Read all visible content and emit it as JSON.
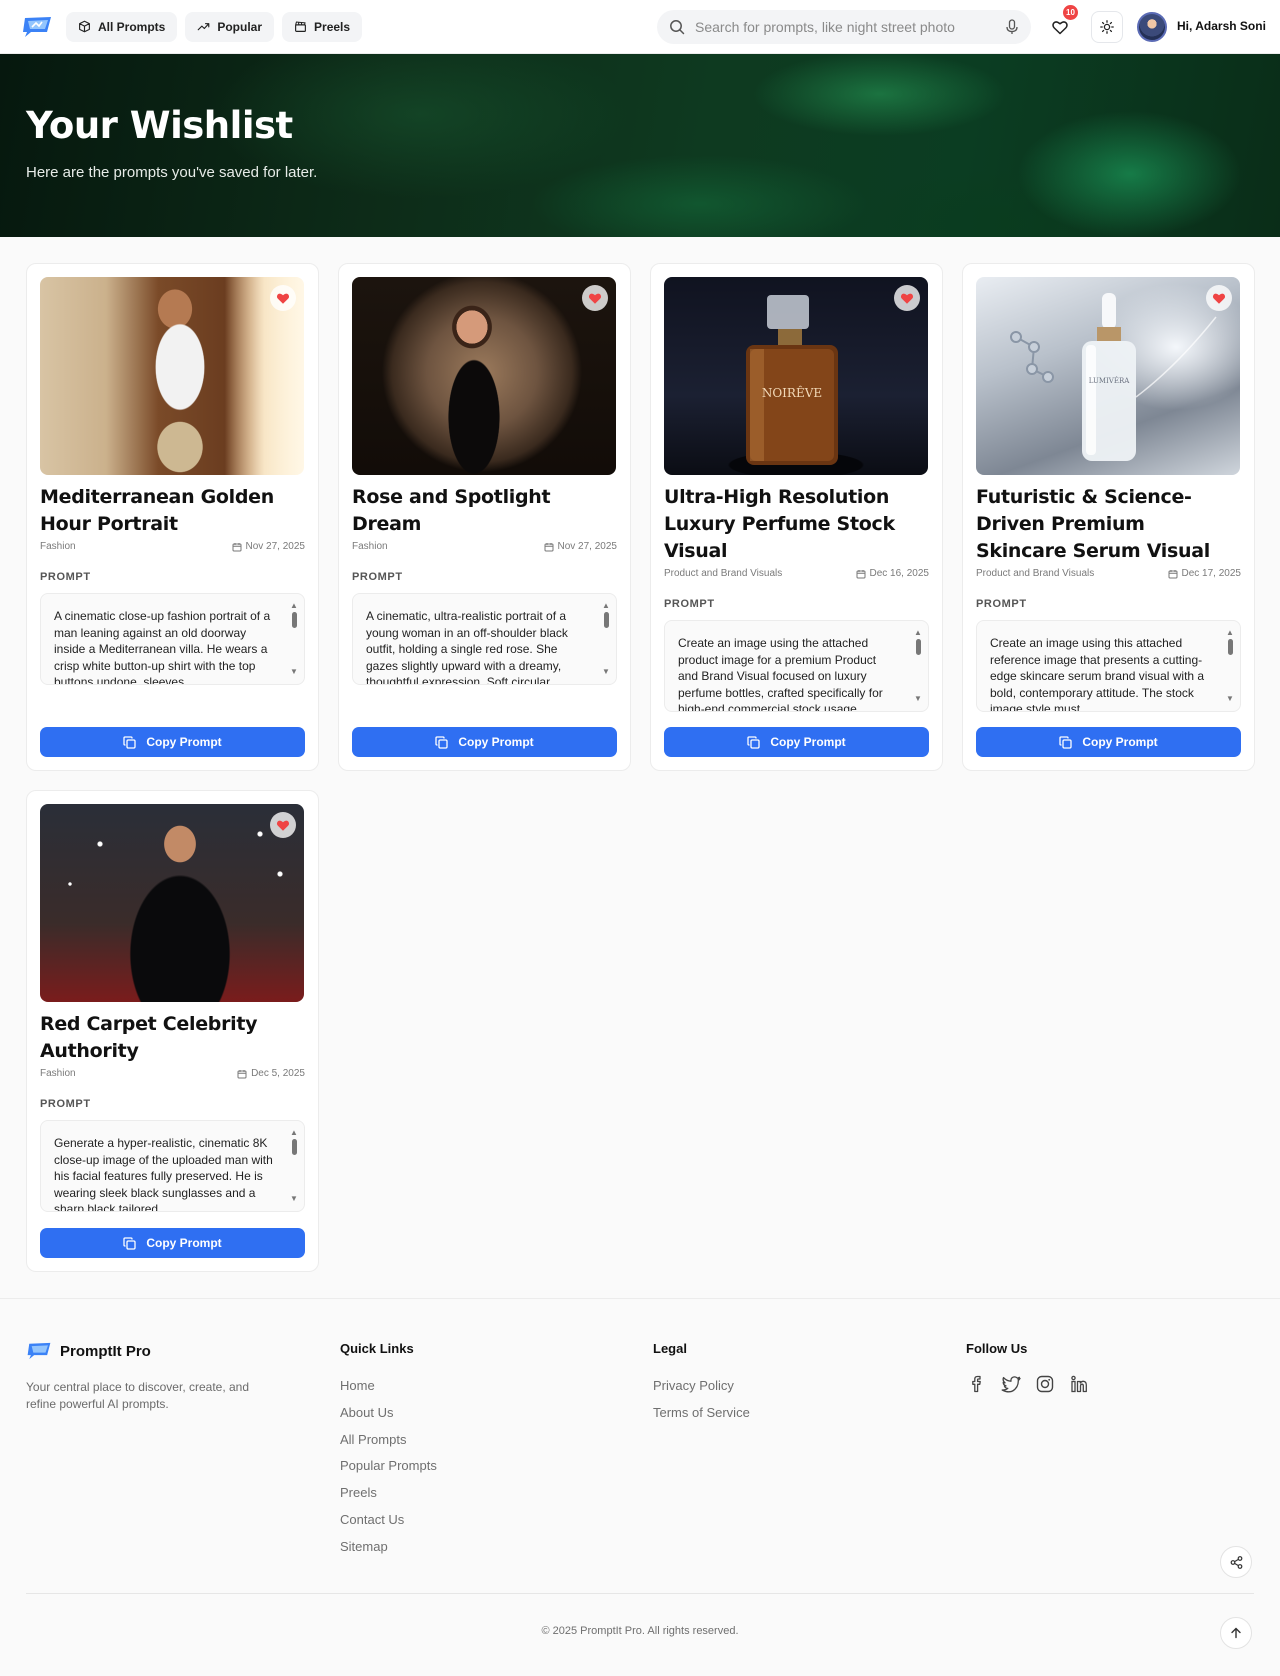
{
  "header": {
    "nav": [
      {
        "label": "All Prompts",
        "icon": "cube-icon"
      },
      {
        "label": "Popular",
        "icon": "trending-up-icon"
      },
      {
        "label": "Preels",
        "icon": "clapperboard-icon"
      }
    ],
    "search_placeholder": "Search for prompts, like night street photo",
    "wishlist_count": "10",
    "greeting": "Hi, Adarsh Soni"
  },
  "hero": {
    "title": "Your Wishlist",
    "subtitle": "Here are the prompts you've saved for later."
  },
  "cards": [
    {
      "title": "Mediterranean Golden Hour Portrait",
      "category": "Fashion",
      "date": "Nov 27, 2025",
      "prompt_label": "PROMPT",
      "prompt": "A cinematic close-up fashion portrait of a man leaning against an old doorway inside a Mediterranean villa. He wears a crisp white button-up shirt with the top buttons undone, sleeves",
      "button": "Copy Prompt"
    },
    {
      "title": "Rose and Spotlight Dream",
      "category": "Fashion",
      "date": "Nov 27, 2025",
      "prompt_label": "PROMPT",
      "prompt": "A cinematic, ultra-realistic portrait of a young woman in an off-shoulder black outfit, holding a single red rose. She gazes slightly upward with a dreamy, thoughtful expression. Soft circular",
      "button": "Copy Prompt"
    },
    {
      "title": "Ultra-High Resolution Luxury Perfume Stock Visual",
      "category": "Product and Brand Visuals",
      "date": "Dec 16, 2025",
      "prompt_label": "PROMPT",
      "prompt": "Create an image using the attached product image for a premium Product and Brand Visual focused on luxury perfume bottles, crafted specifically for high-end commercial stock usage.",
      "button": "Copy Prompt",
      "label_on_bottle": "NOIRÊVE"
    },
    {
      "title": "Futuristic & Science-Driven Premium Skincare Serum Visual",
      "category": "Product and Brand Visuals",
      "date": "Dec 17, 2025",
      "prompt_label": "PROMPT",
      "prompt": "Create an image using this attached reference image that presents a cutting-edge skincare serum brand visual with a bold, contemporary attitude. The stock image style must",
      "button": "Copy Prompt",
      "label_on_bottle": "LUMIVÉRA"
    },
    {
      "title": "Red Carpet Celebrity Authority",
      "category": "Fashion",
      "date": "Dec 5, 2025",
      "prompt_label": "PROMPT",
      "prompt": "Generate a hyper-realistic, cinematic 8K close-up image of the uploaded man with his facial features fully preserved. He is wearing sleek black sunglasses and a sharp black tailored",
      "button": "Copy Prompt"
    }
  ],
  "footer": {
    "brand": "PromptIt Pro",
    "description": "Your central place to discover, create, and refine powerful AI prompts.",
    "quick_links_title": "Quick Links",
    "quick_links": [
      "Home",
      "About Us",
      "All Prompts",
      "Popular Prompts",
      "Preels",
      "Contact Us",
      "Sitemap"
    ],
    "legal_title": "Legal",
    "legal_links": [
      "Privacy Policy",
      "Terms of Service"
    ],
    "follow_title": "Follow Us",
    "socials": [
      "facebook-icon",
      "twitter-icon",
      "instagram-icon",
      "linkedin-icon"
    ],
    "copyright": "© 2025 PromptIt Pro. All rights reserved."
  },
  "colors": {
    "accent": "#2f6ff2",
    "heart": "#ef4444",
    "hero_green": "#0e3a20"
  }
}
